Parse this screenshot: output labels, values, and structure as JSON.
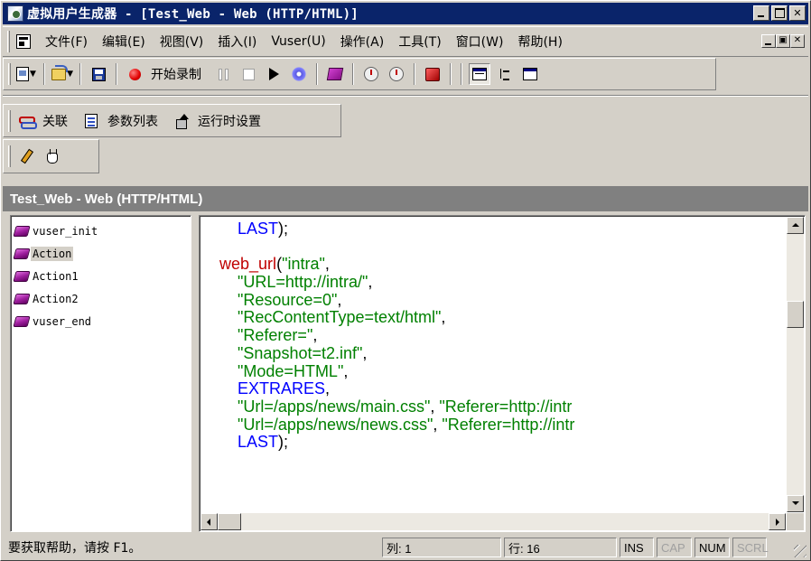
{
  "window": {
    "title": "虚拟用户生成器 - [Test_Web - Web (HTTP/HTML)]"
  },
  "menu": {
    "items": [
      "文件(F)",
      "编辑(E)",
      "视图(V)",
      "插入(I)",
      "Vuser(U)",
      "操作(A)",
      "工具(T)",
      "窗口(W)",
      "帮助(H)"
    ]
  },
  "toolbar": {
    "record_label": "开始录制",
    "correlation_label": "关联",
    "param_list_label": "参数列表",
    "runtime_settings_label": "运行时设置"
  },
  "document": {
    "caption": "Test_Web - Web (HTTP/HTML)"
  },
  "tree": {
    "items": [
      "vuser_init",
      "Action",
      "Action1",
      "Action2",
      "vuser_end"
    ],
    "selected": "Action"
  },
  "code": {
    "lines": [
      [
        {
          "t": "        ",
          "c": "black"
        },
        {
          "t": "LAST",
          "c": "blue"
        },
        {
          "t": ");",
          "c": "black"
        }
      ],
      [
        {
          "t": "",
          "c": "black"
        }
      ],
      [
        {
          "t": "    ",
          "c": "black"
        },
        {
          "t": "web_url",
          "c": "red"
        },
        {
          "t": "(",
          "c": "black"
        },
        {
          "t": "\"intra\"",
          "c": "green"
        },
        {
          "t": ",",
          "c": "black"
        }
      ],
      [
        {
          "t": "        ",
          "c": "black"
        },
        {
          "t": "\"URL=http://intra/\"",
          "c": "green"
        },
        {
          "t": ",",
          "c": "black"
        }
      ],
      [
        {
          "t": "        ",
          "c": "black"
        },
        {
          "t": "\"Resource=0\"",
          "c": "green"
        },
        {
          "t": ",",
          "c": "black"
        }
      ],
      [
        {
          "t": "        ",
          "c": "black"
        },
        {
          "t": "\"RecContentType=text/html\"",
          "c": "green"
        },
        {
          "t": ",",
          "c": "black"
        }
      ],
      [
        {
          "t": "        ",
          "c": "black"
        },
        {
          "t": "\"Referer=\"",
          "c": "green"
        },
        {
          "t": ",",
          "c": "black"
        }
      ],
      [
        {
          "t": "        ",
          "c": "black"
        },
        {
          "t": "\"Snapshot=t2.inf\"",
          "c": "green"
        },
        {
          "t": ",",
          "c": "black"
        }
      ],
      [
        {
          "t": "        ",
          "c": "black"
        },
        {
          "t": "\"Mode=HTML\"",
          "c": "green"
        },
        {
          "t": ",",
          "c": "black"
        }
      ],
      [
        {
          "t": "        ",
          "c": "black"
        },
        {
          "t": "EXTRARES",
          "c": "blue"
        },
        {
          "t": ",",
          "c": "black"
        }
      ],
      [
        {
          "t": "        ",
          "c": "black"
        },
        {
          "t": "\"Url=/apps/news/main.css\"",
          "c": "green"
        },
        {
          "t": ", ",
          "c": "black"
        },
        {
          "t": "\"Referer=http://intr",
          "c": "green"
        }
      ],
      [
        {
          "t": "        ",
          "c": "black"
        },
        {
          "t": "\"Url=/apps/news/news.css\"",
          "c": "green"
        },
        {
          "t": ", ",
          "c": "black"
        },
        {
          "t": "\"Referer=http://intr",
          "c": "green"
        }
      ],
      [
        {
          "t": "        ",
          "c": "black"
        },
        {
          "t": "LAST",
          "c": "blue"
        },
        {
          "t": ");",
          "c": "black"
        }
      ]
    ]
  },
  "status": {
    "message": "要获取帮助，请按 F1。",
    "col": "列: 1",
    "row": "行: 16",
    "ins": "INS",
    "cap": "CAP",
    "num": "NUM",
    "scrl": "SCRL"
  },
  "colors": {
    "titlebar": "#0a246a",
    "keyword": "#0000ff",
    "string": "#008000",
    "function": "#c00000"
  }
}
